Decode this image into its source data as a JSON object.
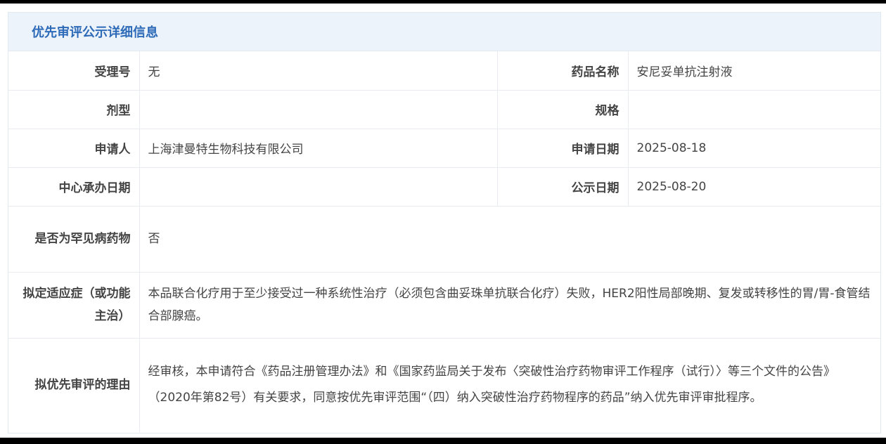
{
  "panel": {
    "title": "优先审评公示详细信息"
  },
  "fields": {
    "acceptance_no": {
      "label": "受理号",
      "value": "无"
    },
    "drug_name": {
      "label": "药品名称",
      "value": "安尼妥单抗注射液"
    },
    "dosage_form": {
      "label": "剂型",
      "value": ""
    },
    "specification": {
      "label": "规格",
      "value": ""
    },
    "applicant": {
      "label": "申请人",
      "value": "上海津曼特生物科技有限公司"
    },
    "apply_date": {
      "label": "申请日期",
      "value": "2025-08-18"
    },
    "center_date": {
      "label": "中心承办日期",
      "value": ""
    },
    "publish_date": {
      "label": "公示日期",
      "value": "2025-08-20"
    },
    "rare_disease": {
      "label": "是否为罕见病药物",
      "value": "否"
    },
    "indication": {
      "label": "拟定适应症（或功能主治）",
      "value": "本品联合化疗用于至少接受过一种系统性治疗（必须包含曲妥珠单抗联合化疗）失败，HER2阳性局部晚期、复发或转移性的胃/胃-食管结合部腺癌。"
    },
    "reason": {
      "label": "拟优先审评的理由",
      "value": "经审核，本申请符合《药品注册管理办法》和《国家药监局关于发布〈突破性治疗药物审评工作程序（试行）〉等三个文件的公告》（2020年第82号）有关要求，同意按优先审评范围“（四）纳入突破性治疗药物程序的药品”纳入优先审评审批程序。"
    }
  },
  "colors": {
    "header_bg": "#edf3fb",
    "title": "#2d6ab8",
    "border": "#e8ecf1"
  }
}
